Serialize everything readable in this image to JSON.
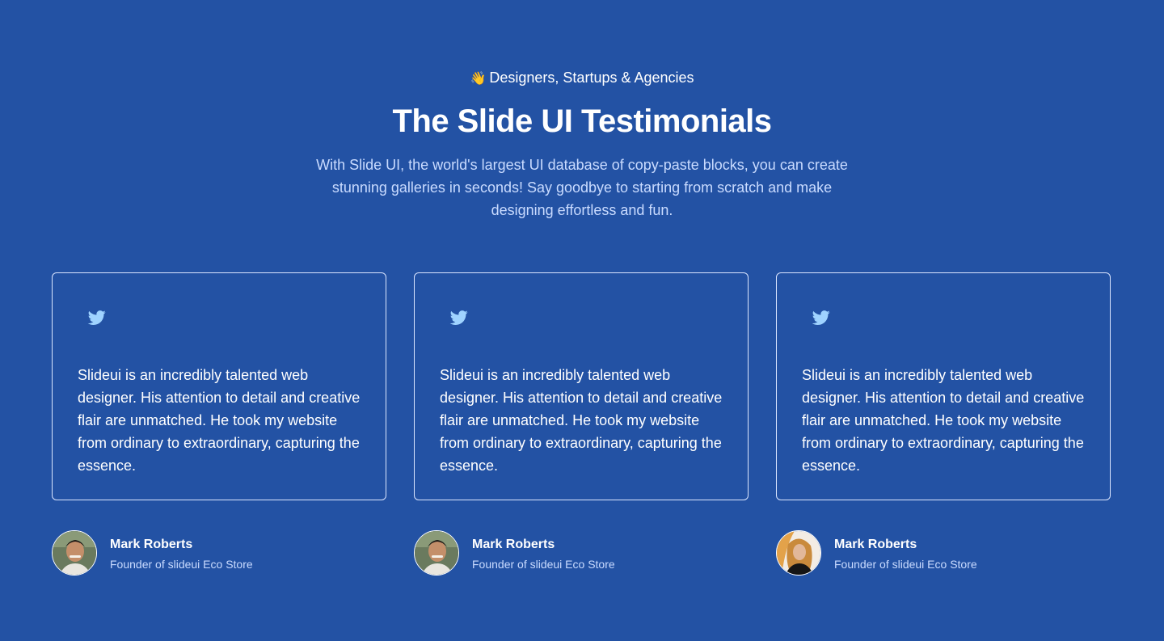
{
  "header": {
    "eyebrow_emoji": "👋",
    "eyebrow_text": "Designers, Startups & Agencies",
    "title": "The Slide UI Testimonials",
    "description": "With Slide UI, the world's largest UI database of copy-paste blocks, you can create stunning galleries in seconds! Say goodbye to starting from scratch and make designing effortless and fun."
  },
  "colors": {
    "background": "#2352a4",
    "card_border": "#dbe6ff",
    "muted_text": "#c9dbff",
    "twitter_icon": "#9fd3ff"
  },
  "testimonials": [
    {
      "icon": "twitter-icon",
      "quote": "Slideui is an incredibly talented web designer. His attention to detail and creative flair are unmatched. He took my website from ordinary to extraordinary, capturing the essence.",
      "author_name": "Mark Roberts",
      "author_role": "Founder of slideui Eco Store"
    },
    {
      "icon": "twitter-icon",
      "quote": "Slideui is an incredibly talented web designer. His attention to detail and creative flair are unmatched. He took my website from ordinary to extraordinary, capturing the essence.",
      "author_name": "Mark Roberts",
      "author_role": "Founder of slideui Eco Store"
    },
    {
      "icon": "twitter-icon",
      "quote": "Slideui is an incredibly talented web designer. His attention to detail and creative flair are unmatched. He took my website from ordinary to extraordinary, capturing the essence.",
      "author_name": "Mark Roberts",
      "author_role": "Founder of slideui Eco Store"
    }
  ]
}
